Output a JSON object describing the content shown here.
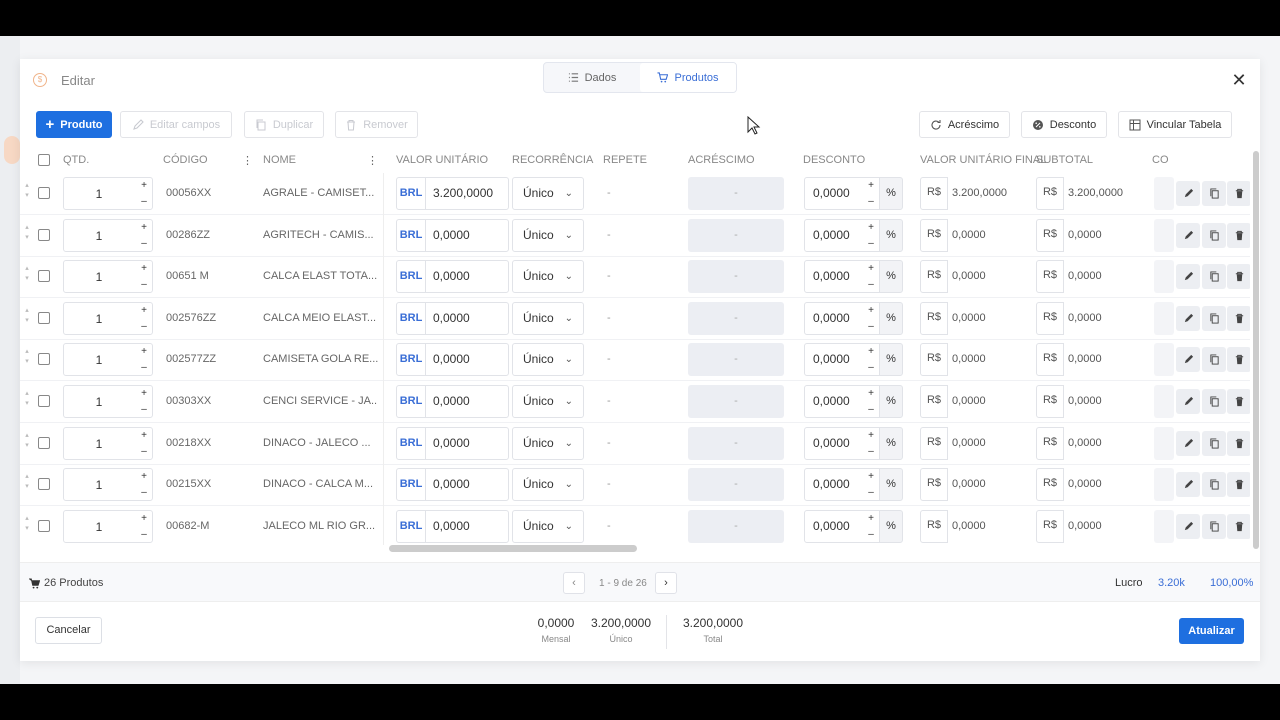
{
  "modal": {
    "title": "Editar",
    "tabs": [
      {
        "label": "Dados",
        "icon": "list-icon",
        "active": false
      },
      {
        "label": "Produtos",
        "icon": "cart-icon",
        "active": true
      }
    ]
  },
  "toolbar": {
    "add_product": "Produto",
    "edit_fields": "Editar campos",
    "duplicate": "Duplicar",
    "remove": "Remover",
    "surcharge": "Acréscimo",
    "discount": "Desconto",
    "link_table": "Vincular Tabela"
  },
  "table": {
    "headers": {
      "qty": "QTD.",
      "code": "CÓDIGO",
      "name": "NOME",
      "unit_value": "VALOR UNITÁRIO",
      "recurrence": "RECORRÊNCIA",
      "repeat": "REPETE",
      "surcharge": "ACRÉSCIMO",
      "discount": "DESCONTO",
      "final_unit_value": "VALOR UNITÁRIO FINAL",
      "subtotal": "SUBTOTAL",
      "co": "CO"
    },
    "rows": [
      {
        "qty": "1",
        "code": "00056XX",
        "name": "AGRALE - CAMISET...",
        "currency": "BRL",
        "unit_value": "3.200,0000",
        "recurrence": "Único",
        "repeat": "-",
        "surcharge": "-",
        "discount": "0,0000",
        "pct": "%",
        "rs1": "R$",
        "final": "3.200,0000",
        "rs2": "R$",
        "subtotal": "3.200,0000"
      },
      {
        "qty": "1",
        "code": "00286ZZ",
        "name": "AGRITECH - CAMIS...",
        "currency": "BRL",
        "unit_value": "0,0000",
        "recurrence": "Único",
        "repeat": "-",
        "surcharge": "-",
        "discount": "0,0000",
        "pct": "%",
        "rs1": "R$",
        "final": "0,0000",
        "rs2": "R$",
        "subtotal": "0,0000"
      },
      {
        "qty": "1",
        "code": "00651 M",
        "name": "CALCA ELAST TOTA...",
        "currency": "BRL",
        "unit_value": "0,0000",
        "recurrence": "Único",
        "repeat": "-",
        "surcharge": "-",
        "discount": "0,0000",
        "pct": "%",
        "rs1": "R$",
        "final": "0,0000",
        "rs2": "R$",
        "subtotal": "0,0000"
      },
      {
        "qty": "1",
        "code": "002576ZZ",
        "name": "CALCA MEIO ELAST...",
        "currency": "BRL",
        "unit_value": "0,0000",
        "recurrence": "Único",
        "repeat": "-",
        "surcharge": "-",
        "discount": "0,0000",
        "pct": "%",
        "rs1": "R$",
        "final": "0,0000",
        "rs2": "R$",
        "subtotal": "0,0000"
      },
      {
        "qty": "1",
        "code": "002577ZZ",
        "name": "CAMISETA GOLA RE...",
        "currency": "BRL",
        "unit_value": "0,0000",
        "recurrence": "Único",
        "repeat": "-",
        "surcharge": "-",
        "discount": "0,0000",
        "pct": "%",
        "rs1": "R$",
        "final": "0,0000",
        "rs2": "R$",
        "subtotal": "0,0000"
      },
      {
        "qty": "1",
        "code": "00303XX",
        "name": "CENCI SERVICE - JA...",
        "currency": "BRL",
        "unit_value": "0,0000",
        "recurrence": "Único",
        "repeat": "-",
        "surcharge": "-",
        "discount": "0,0000",
        "pct": "%",
        "rs1": "R$",
        "final": "0,0000",
        "rs2": "R$",
        "subtotal": "0,0000"
      },
      {
        "qty": "1",
        "code": "00218XX",
        "name": "DINACO - JALECO ...",
        "currency": "BRL",
        "unit_value": "0,0000",
        "recurrence": "Único",
        "repeat": "-",
        "surcharge": "-",
        "discount": "0,0000",
        "pct": "%",
        "rs1": "R$",
        "final": "0,0000",
        "rs2": "R$",
        "subtotal": "0,0000"
      },
      {
        "qty": "1",
        "code": "00215XX",
        "name": "DINACO - CALCA M...",
        "currency": "BRL",
        "unit_value": "0,0000",
        "recurrence": "Único",
        "repeat": "-",
        "surcharge": "-",
        "discount": "0,0000",
        "pct": "%",
        "rs1": "R$",
        "final": "0,0000",
        "rs2": "R$",
        "subtotal": "0,0000"
      },
      {
        "qty": "1",
        "code": "00682-M",
        "name": "JALECO ML RIO GR...",
        "currency": "BRL",
        "unit_value": "0,0000",
        "recurrence": "Único",
        "repeat": "-",
        "surcharge": "-",
        "discount": "0,0000",
        "pct": "%",
        "rs1": "R$",
        "final": "0,0000",
        "rs2": "R$",
        "subtotal": "0,0000"
      }
    ]
  },
  "footer": {
    "product_count": "26 Produtos",
    "pagination": "1 - 9 de 26",
    "prev": "‹",
    "next": "›",
    "profit_label": "Lucro",
    "profit_value": "3.20k",
    "profit_pct": "100,00%"
  },
  "bottom": {
    "cancel": "Cancelar",
    "monthly_value": "0,0000",
    "monthly_label": "Mensal",
    "single_value": "3.200,0000",
    "single_label": "Único",
    "total_value": "3.200,0000",
    "total_label": "Total",
    "update": "Atualizar"
  },
  "colors": {
    "primary": "#1e6fe0",
    "accent": "#3a6ed6",
    "brand": "#f0b48a"
  }
}
